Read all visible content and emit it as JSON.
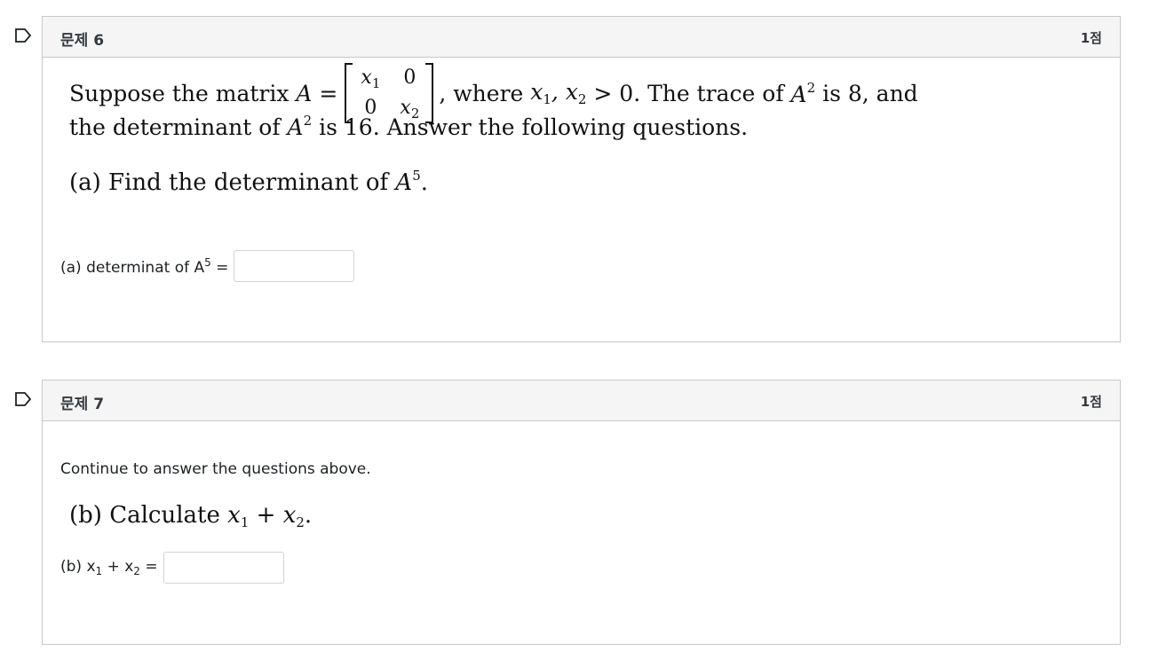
{
  "questions": [
    {
      "title": "문제 6",
      "mark": "1점",
      "text": {
        "intro": "Suppose the matrix",
        "var_A": "A",
        "equals": "=",
        "matrix": [
          "x1",
          "0",
          "0",
          "x2"
        ],
        "where": ", where",
        "condition": "x1, x2 > 0.",
        "trace_part": "The trace of",
        "trace_value": "is 8, and",
        "line2_a": "the determinant of",
        "line2_b": "is 16. Answer the following questions.",
        "part_a": "(a) Find the determinant of"
      },
      "answer_label": "(a) determinat of A",
      "answer_sup": "5",
      "answer_eq": "=",
      "answer_value": ""
    },
    {
      "title": "문제 7",
      "mark": "1점",
      "text": {
        "intro": "Continue to answer the questions above.",
        "part_b": "(b) Calculate"
      },
      "answer_label": "(b) x",
      "answer_value": ""
    }
  ]
}
